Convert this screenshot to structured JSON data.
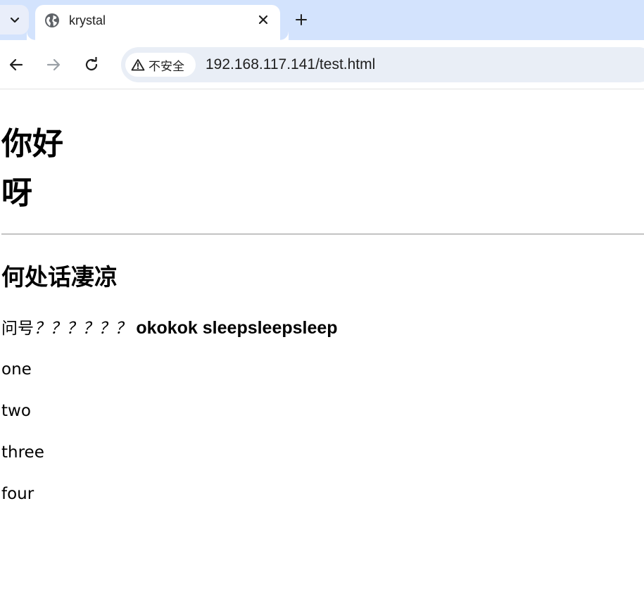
{
  "browser": {
    "tab": {
      "title": "krystal",
      "favicon": "globe-icon"
    },
    "toolbar": {
      "security_label": "不安全",
      "url": "192.168.117.141/test.html"
    },
    "colors": {
      "tabstrip_bg": "#d3e3fd",
      "omnibox_bg": "#e9eef6"
    }
  },
  "page": {
    "heading1_lines": [
      "你好",
      "呀"
    ],
    "heading2": "何处话凄凉",
    "question_line": {
      "prefix": "问号",
      "italic": "？？？？？？",
      "bold": "okokok sleepsleepsleep"
    },
    "items": [
      "one",
      "two",
      "three",
      "four"
    ]
  }
}
